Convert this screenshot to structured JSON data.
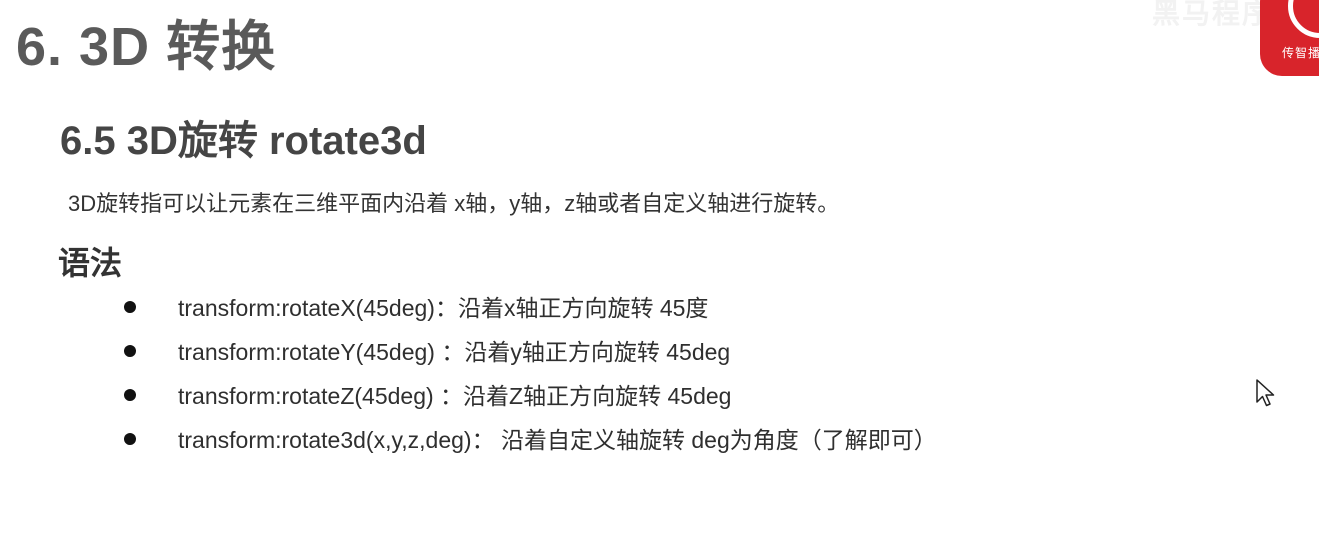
{
  "slide": {
    "title": "6. 3D 转换",
    "section_heading": "6.5 3D旋转 rotate3d",
    "intro": "3D旋转指可以让元素在三维平面内沿着 x轴，y轴，z轴或者自定义轴进行旋转。",
    "syntax_label": "语法",
    "bullets": [
      "transform:rotateX(45deg)：沿着x轴正方向旋转 45度",
      "transform:rotateY(45deg) ：沿着y轴正方向旋转 45deg",
      "transform:rotateZ(45deg) ：沿着Z轴正方向旋转 45deg",
      "transform:rotate3d(x,y,z,deg)： 沿着自定义轴旋转 deg为角度（了解即可）"
    ]
  },
  "branding": {
    "logo_text": "传智播",
    "watermark": "黑马程序员",
    "logo_color": "#d8242b"
  },
  "icons": {
    "bullet": "bullet-dot-icon",
    "cursor": "mouse-pointer-icon"
  }
}
